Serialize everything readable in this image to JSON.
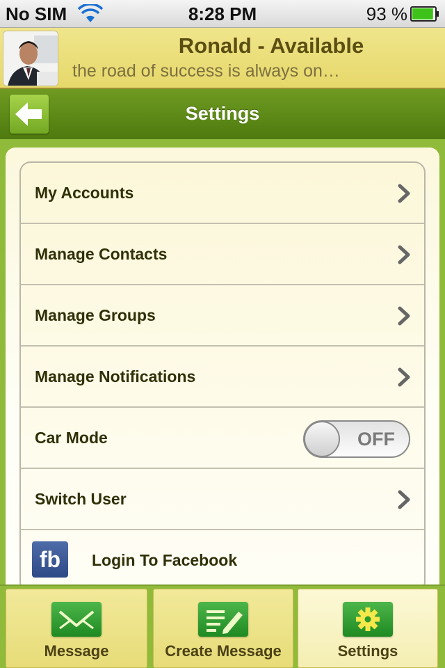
{
  "status_bar": {
    "carrier": "No SIM",
    "time": "8:28 PM",
    "battery_percent": "93 %",
    "battery_level": 0.93,
    "icons": [
      "wifi-icon",
      "battery-icon"
    ]
  },
  "profile": {
    "name": "Ronald - Available",
    "status_message": "the road of success is always on…"
  },
  "navbar": {
    "title": "Settings",
    "back_icon": "arrow-left-icon"
  },
  "settings": {
    "items": [
      {
        "label": "My Accounts",
        "type": "link"
      },
      {
        "label": "Manage Contacts",
        "type": "link"
      },
      {
        "label": "Manage Groups",
        "type": "link"
      },
      {
        "label": "Manage Notifications",
        "type": "link"
      },
      {
        "label": "Car Mode",
        "type": "toggle",
        "value": "OFF"
      },
      {
        "label": "Switch User",
        "type": "link"
      },
      {
        "label": "Login To Facebook",
        "type": "facebook",
        "icon_text": "fb"
      }
    ]
  },
  "tabbar": {
    "tabs": [
      {
        "label": "Message",
        "icon": "envelope-icon",
        "active": false
      },
      {
        "label": "Create Message",
        "icon": "compose-icon",
        "active": false
      },
      {
        "label": "Settings",
        "icon": "gear-icon",
        "active": true
      }
    ]
  },
  "colors": {
    "header_yellow": "#e6d86a",
    "nav_green": "#5a8618",
    "background_green": "#8fba3a",
    "icon_green": "#2a9a2c",
    "text_dark": "#2f3008"
  }
}
